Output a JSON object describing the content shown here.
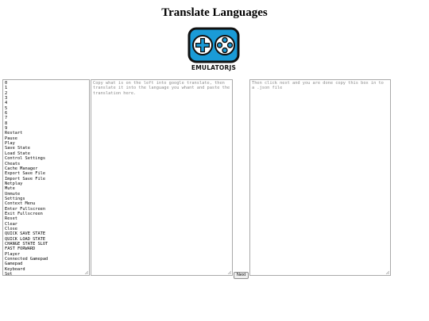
{
  "page": {
    "title": "Translate Languages"
  },
  "logo": {
    "text": "EMULATORJS",
    "accent_color": "#1a9bd7",
    "outline_color": "#111111"
  },
  "source_list": {
    "items": [
      "0",
      "1",
      "2",
      "3",
      "4",
      "5",
      "6",
      "7",
      "8",
      "9",
      "Restart",
      "Pause",
      "Play",
      "Save State",
      "Load State",
      "Control Settings",
      "Cheats",
      "Cache Manager",
      "Export Save File",
      "Import Save File",
      "Netplay",
      "Mute",
      "Unmute",
      "Settings",
      "Context Menu",
      "Enter Fullscreen",
      "Exit Fullscreen",
      "Reset",
      "Clear",
      "Close",
      "QUICK SAVE STATE",
      "QUICK LOAD STATE",
      "CHANGE STATE SLOT",
      "FAST FORWARD",
      "Player",
      "Connected Gamepad",
      "Gamepad",
      "Keyboard",
      "Set"
    ]
  },
  "translation_box": {
    "placeholder": "Copy what is on the left into google translate, then translate it into the language you whant and paste the translation here."
  },
  "output_box": {
    "placeholder": "Then click next and you are done copy this box in to a .json file"
  },
  "next_button": {
    "label": "Next"
  }
}
